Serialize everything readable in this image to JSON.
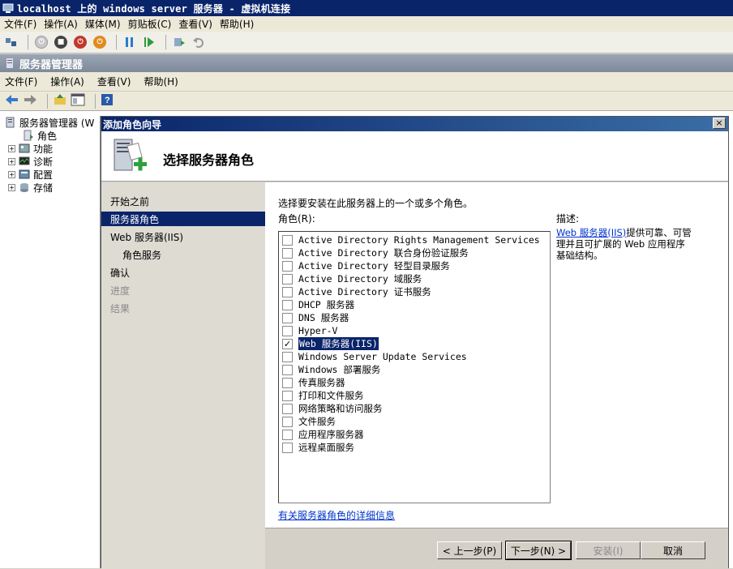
{
  "vm_window": {
    "title": "localhost 上的 windows server 服务器 - 虚拟机连接",
    "menu": [
      "文件(F)",
      "操作(A)",
      "媒体(M)",
      "剪贴板(C)",
      "查看(V)",
      "帮助(H)"
    ]
  },
  "server_manager": {
    "title": "服务器管理器",
    "menu": [
      "文件(F)",
      "操作(A)",
      "查看(V)",
      "帮助(H)"
    ],
    "tree": {
      "root": "服务器管理器 (W",
      "items": [
        "角色",
        "功能",
        "诊断",
        "配置",
        "存储"
      ]
    }
  },
  "wizard": {
    "title": "添加角色向导",
    "close": "×",
    "header": "选择服务器角色",
    "steps": [
      {
        "label": "开始之前",
        "state": "normal"
      },
      {
        "label": "服务器角色",
        "state": "active"
      },
      {
        "label": "Web 服务器(IIS)",
        "state": "normal"
      },
      {
        "label": "角色服务",
        "state": "normal"
      },
      {
        "label": "确认",
        "state": "normal"
      },
      {
        "label": "进度",
        "state": "disabled"
      },
      {
        "label": "结果",
        "state": "disabled"
      }
    ],
    "instruction": "选择要安装在此服务器上的一个或多个角色。",
    "roles_label": "角色(R):",
    "roles": [
      {
        "label": "Active Directory Rights Management Services",
        "checked": false
      },
      {
        "label": "Active Directory 联合身份验证服务",
        "checked": false
      },
      {
        "label": "Active Directory 轻型目录服务",
        "checked": false
      },
      {
        "label": "Active Directory 域服务",
        "checked": false
      },
      {
        "label": "Active Directory 证书服务",
        "checked": false
      },
      {
        "label": "DHCP 服务器",
        "checked": false
      },
      {
        "label": "DNS 服务器",
        "checked": false
      },
      {
        "label": "Hyper-V",
        "checked": false
      },
      {
        "label": "Web 服务器(IIS)",
        "checked": true
      },
      {
        "label": "Windows Server Update Services",
        "checked": false
      },
      {
        "label": "Windows 部署服务",
        "checked": false
      },
      {
        "label": "传真服务器",
        "checked": false
      },
      {
        "label": "打印和文件服务",
        "checked": false
      },
      {
        "label": "网络策略和访问服务",
        "checked": false
      },
      {
        "label": "文件服务",
        "checked": false
      },
      {
        "label": "应用程序服务器",
        "checked": false
      },
      {
        "label": "远程桌面服务",
        "checked": false
      }
    ],
    "description_label": "描述:",
    "description_link": "Web 服务器(IIS)",
    "description_text": "提供可靠、可管理并且可扩展的 Web 应用程序基础结构。",
    "more_info_link": "有关服务器角色的详细信息",
    "buttons": {
      "back": "< 上一步(P)",
      "next": "下一步(N) >",
      "install": "安装(I)",
      "cancel": "取消"
    }
  }
}
